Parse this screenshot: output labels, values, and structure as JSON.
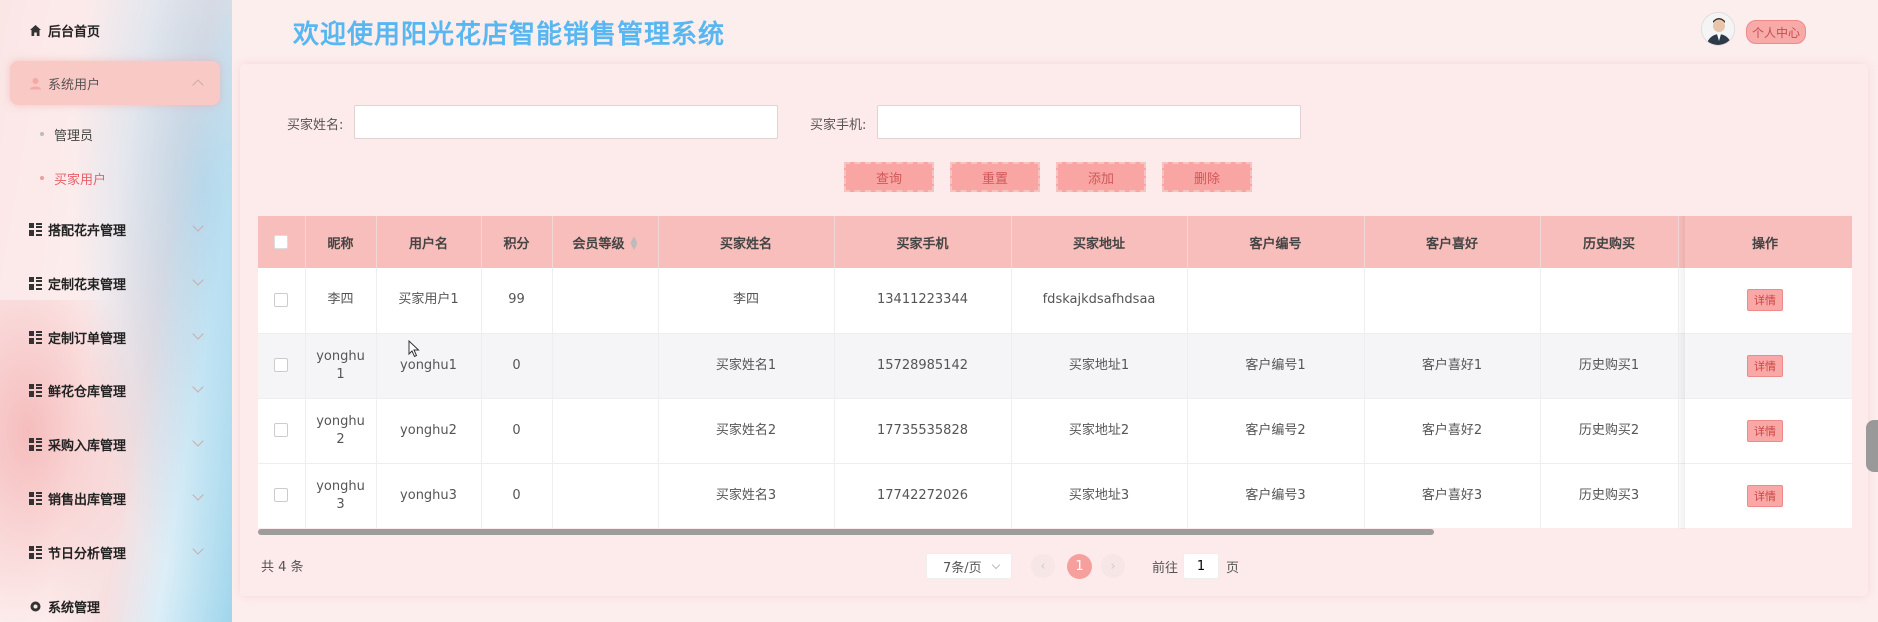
{
  "sidebar": {
    "items": [
      {
        "label": "后台首页"
      },
      {
        "label": "系统用户"
      },
      {
        "label": "搭配花卉管理"
      },
      {
        "label": "定制花束管理"
      },
      {
        "label": "定制订单管理"
      },
      {
        "label": "鲜花仓库管理"
      },
      {
        "label": "采购入库管理"
      },
      {
        "label": "销售出库管理"
      },
      {
        "label": "节日分析管理"
      },
      {
        "label": "系统管理"
      }
    ],
    "sub_items": [
      {
        "label": "管理员"
      },
      {
        "label": "买家用户"
      }
    ]
  },
  "header": {
    "title": "欢迎使用阳光花店智能销售管理系统",
    "profile_label": "个人中心"
  },
  "search": {
    "name_label": "买家姓名:",
    "name_value": "",
    "phone_label": "买家手机:",
    "phone_value": ""
  },
  "actions": {
    "query": "查询",
    "reset": "重置",
    "add": "添加",
    "delete": "删除"
  },
  "table": {
    "columns": [
      "昵称",
      "用户名",
      "积分",
      "会员等级",
      "买家姓名",
      "买家手机",
      "买家地址",
      "客户编号",
      "客户喜好",
      "历史购买",
      "操作"
    ],
    "rows": [
      {
        "nickname": "李四",
        "username": "买家用户1",
        "points": "99",
        "level": "",
        "name": "李四",
        "phone": "13411223344",
        "address": "fdskajkdsafhdsaa",
        "customer_no": "",
        "preference": "",
        "history": "",
        "action": "详情"
      },
      {
        "nickname": "yonghu1",
        "username": "yonghu1",
        "points": "0",
        "level": "",
        "name": "买家姓名1",
        "phone": "15728985142",
        "address": "买家地址1",
        "customer_no": "客户编号1",
        "preference": "客户喜好1",
        "history": "历史购买1",
        "action": "详情"
      },
      {
        "nickname": "yonghu2",
        "username": "yonghu2",
        "points": "0",
        "level": "",
        "name": "买家姓名2",
        "phone": "17735535828",
        "address": "买家地址2",
        "customer_no": "客户编号2",
        "preference": "客户喜好2",
        "history": "历史购买2",
        "action": "详情"
      },
      {
        "nickname": "yonghu3",
        "username": "yonghu3",
        "points": "0",
        "level": "",
        "name": "买家姓名3",
        "phone": "17742272026",
        "address": "买家地址3",
        "customer_no": "客户编号3",
        "preference": "客户喜好3",
        "history": "历史购买3",
        "action": "详情"
      }
    ]
  },
  "pagination": {
    "total": "共 4 条",
    "page_size": "7条/页",
    "current_page": "1",
    "prev": "‹",
    "next": "›",
    "goto_prefix": "前往",
    "goto_value": "1",
    "goto_suffix": "页"
  },
  "colors": {
    "accent": "#f8a5a3",
    "title": "#58b7f0",
    "active_text": "#e8606a"
  }
}
